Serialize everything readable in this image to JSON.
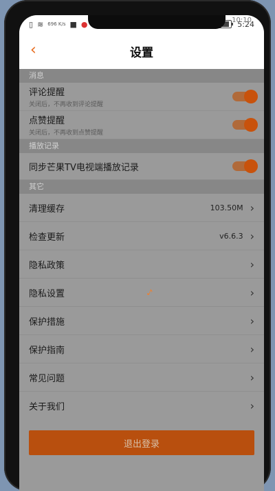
{
  "status_bar": {
    "network_speed": "696\nK/s",
    "time": "5:24",
    "top_corner_time": "10:10"
  },
  "header": {
    "back_icon": "chevron-left-icon",
    "title": "设置"
  },
  "sections": {
    "messages": {
      "header": "消息",
      "comment_reminder": {
        "title": "评论提醒",
        "subtitle": "关闭后，不再收到评论提醒"
      },
      "like_reminder": {
        "title": "点赞提醒",
        "subtitle": "关闭后，不再收到点赞提醒"
      }
    },
    "playback": {
      "header": "播放记录",
      "sync_tv": {
        "title": "同步芒果TV电视端播放记录"
      }
    },
    "others": {
      "header": "其它",
      "items": [
        {
          "label": "清理缓存",
          "value": "103.50M"
        },
        {
          "label": "检查更新",
          "value": "v6.6.3"
        },
        {
          "label": "隐私政策",
          "value": ""
        },
        {
          "label": "隐私设置",
          "value": ""
        },
        {
          "label": "保护措施",
          "value": ""
        },
        {
          "label": "保护指南",
          "value": ""
        },
        {
          "label": "常见问题",
          "value": ""
        },
        {
          "label": "关于我们",
          "value": ""
        }
      ]
    }
  },
  "footer": {
    "logout_label": "退出登录"
  },
  "colors": {
    "accent": "#e86a1a",
    "toggle_on": "#c8520c",
    "logout_bg": "#b84f0e"
  }
}
